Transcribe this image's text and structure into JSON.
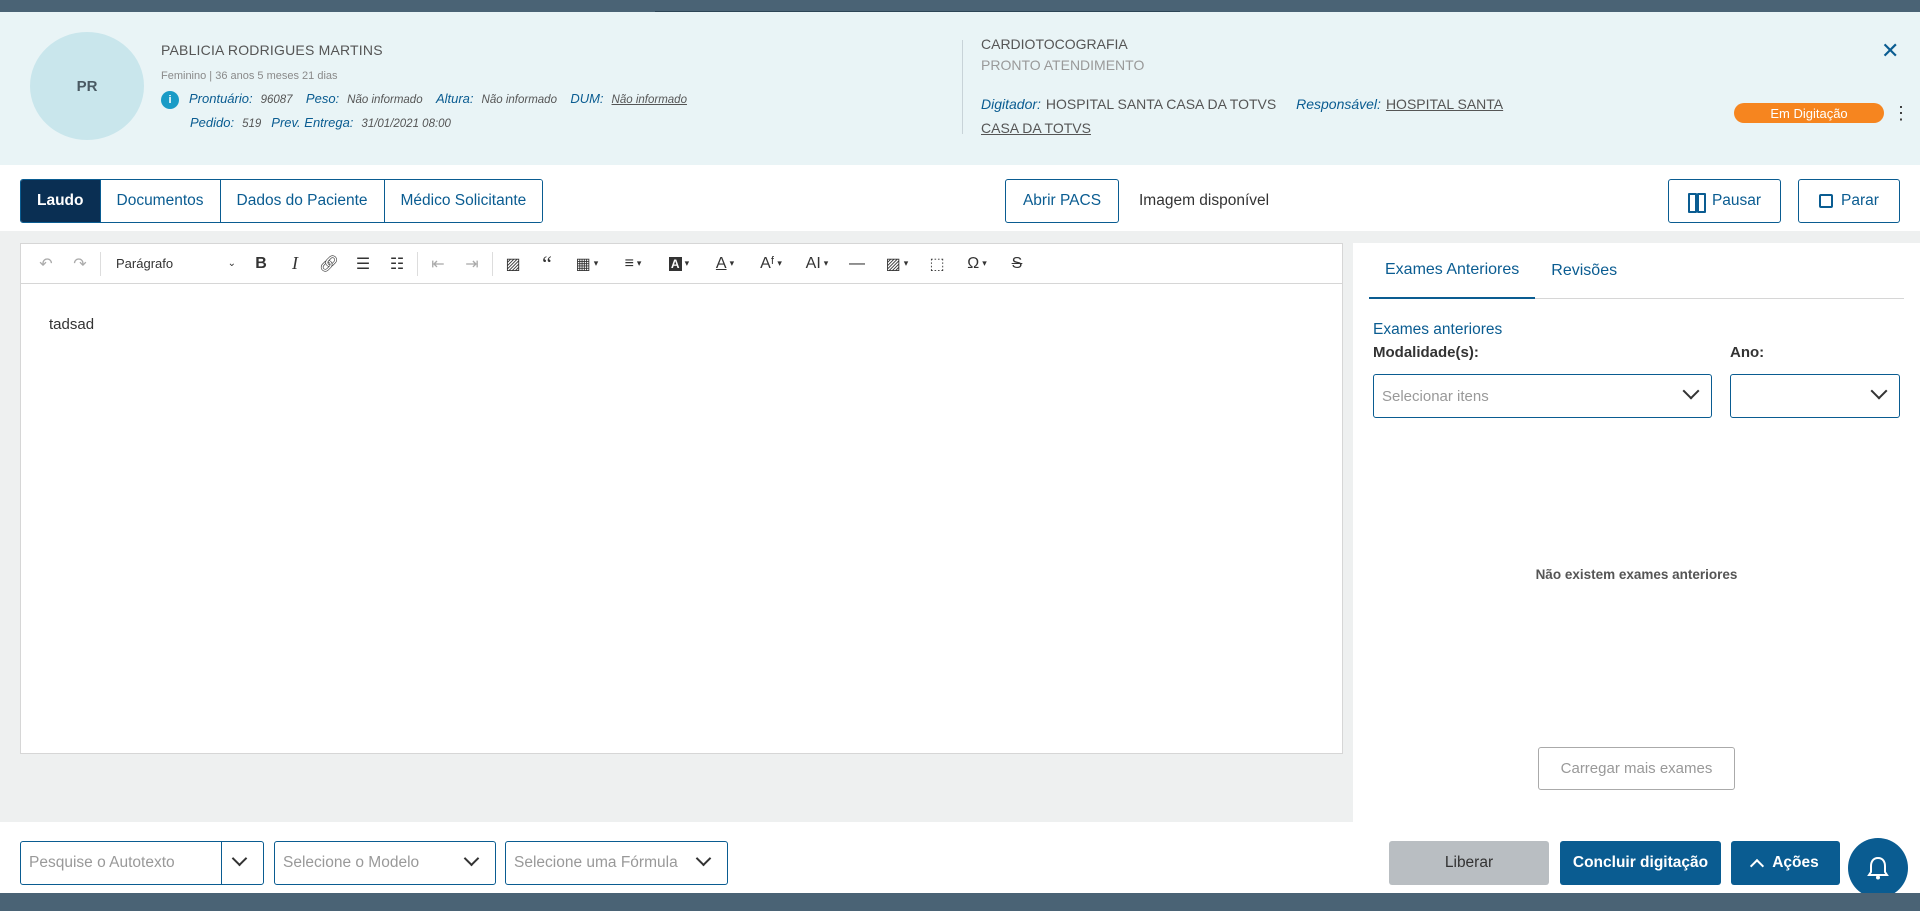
{
  "patient": {
    "initials": "PR",
    "name": "PABLICIA RODRIGUES MARTINS",
    "gender_age": "Feminino | 36 anos 5 meses 21 dias",
    "info_icon": "i",
    "prontuario_label": "Prontuário:",
    "prontuario": "96087",
    "peso_label": "Peso:",
    "peso": "Não informado",
    "altura_label": "Altura:",
    "altura": "Não informado",
    "dum_label": "DUM:",
    "dum": "Não informado",
    "pedido_label": "Pedido:",
    "pedido": "519",
    "prev_label": "Prev. Entrega:",
    "prev_entrega": "31/01/2021 08:00"
  },
  "exam": {
    "title": "CARDIOTOCOGRAFIA",
    "subtitle": "PRONTO ATENDIMENTO",
    "digitador_label": "Digitador:",
    "digitador": "HOSPITAL SANTA CASA DA TOTVS",
    "responsavel_label": "Responsável:",
    "responsavel": "HOSPITAL SANTA CASA DA TOTVS",
    "status": "Em Digitação",
    "status_color": "#f6851f"
  },
  "tabs": [
    {
      "label": "Laudo",
      "active": true
    },
    {
      "label": "Documentos",
      "active": false
    },
    {
      "label": "Dados do Paciente",
      "active": false
    },
    {
      "label": "Médico Solicitante",
      "active": false
    }
  ],
  "pacs": {
    "button": "Abrir PACS",
    "status": "Imagem disponível"
  },
  "controls": {
    "pause": "Pausar",
    "stop": "Parar"
  },
  "editor": {
    "paragraph_style": "Parágrafo",
    "content": "tadsad"
  },
  "side_panel": {
    "tabs": [
      "Exames Anteriores",
      "Revisões"
    ],
    "section_title": "Exames anteriores",
    "modalidade_label": "Modalidade(s):",
    "modalidade_placeholder": "Selecionar itens",
    "ano_label": "Ano:",
    "empty_message": "Não existem exames anteriores",
    "load_more": "Carregar mais exames"
  },
  "footer": {
    "autotext_placeholder": "Pesquise o Autotexto",
    "model_placeholder": "Selecione o Modelo",
    "formula_placeholder": "Selecione uma Fórmula",
    "liberar": "Liberar",
    "concluir": "Concluir digitação",
    "acoes": "Ações"
  },
  "colors": {
    "primary": "#0a5c91",
    "active_tab": "#0a2f53",
    "header_bg": "#e9f4f6",
    "frame": "#4a6375"
  }
}
